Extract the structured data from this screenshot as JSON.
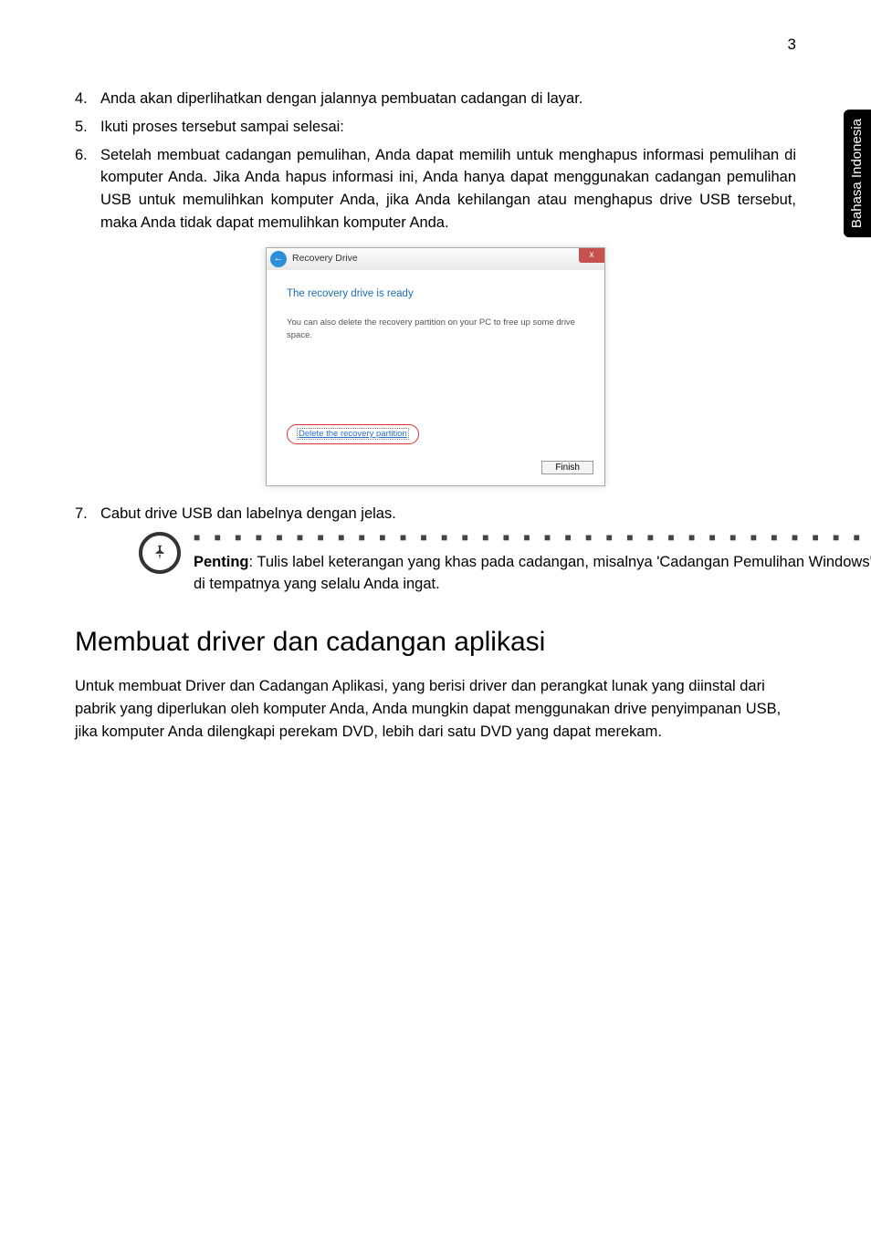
{
  "page_number": "3",
  "side_tab": "Bahasa Indonesia",
  "list": {
    "item4": {
      "num": "4.",
      "text": "Anda akan diperlihatkan dengan jalannya pembuatan cadangan di layar."
    },
    "item5": {
      "num": "5.",
      "text": "Ikuti proses tersebut sampai selesai:"
    },
    "item6": {
      "num": "6.",
      "text": "Setelah membuat cadangan pemulihan, Anda dapat memilih untuk menghapus informasi pemulihan di komputer Anda. Jika Anda hapus informasi ini, Anda hanya dapat menggunakan cadangan pemulihan USB untuk memulihkan komputer Anda, jika Anda kehilangan atau menghapus drive USB tersebut, maka Anda tidak dapat memulihkan komputer Anda."
    },
    "item7": {
      "num": "7.",
      "text": "Cabut drive USB dan labelnya dengan jelas."
    }
  },
  "dialog": {
    "title": "Recovery Drive",
    "heading": "The recovery drive is ready",
    "body_text": "You can also delete the recovery partition on your PC to free up some drive space.",
    "delete_link": "Delete the recovery partition",
    "finish": "Finish",
    "close": "x"
  },
  "note": {
    "label": "Penting",
    "text": ": Tulis label keterangan yang khas pada cadangan, misalnya 'Cadangan Pemulihan Windows' Pastikan cadangan tetap aman di tempatnya yang selalu Anda ingat."
  },
  "section": {
    "heading": "Membuat driver dan cadangan aplikasi",
    "para": "Untuk membuat Driver dan Cadangan Aplikasi, yang berisi driver dan perangkat lunak yang diinstal dari pabrik yang diperlukan oleh komputer Anda, Anda mungkin dapat menggunakan drive penyimpanan USB, jika komputer Anda dilengkapi perekam DVD, lebih dari satu DVD yang dapat merekam."
  },
  "dots": "■ ■ ■ ■ ■ ■ ■ ■ ■ ■ ■ ■ ■ ■ ■ ■ ■ ■ ■ ■ ■ ■ ■ ■ ■ ■ ■ ■ ■ ■ ■ ■ ■ ■ ■ ■ ■ ■ ■ ■ ■ ■ ■ ■"
}
